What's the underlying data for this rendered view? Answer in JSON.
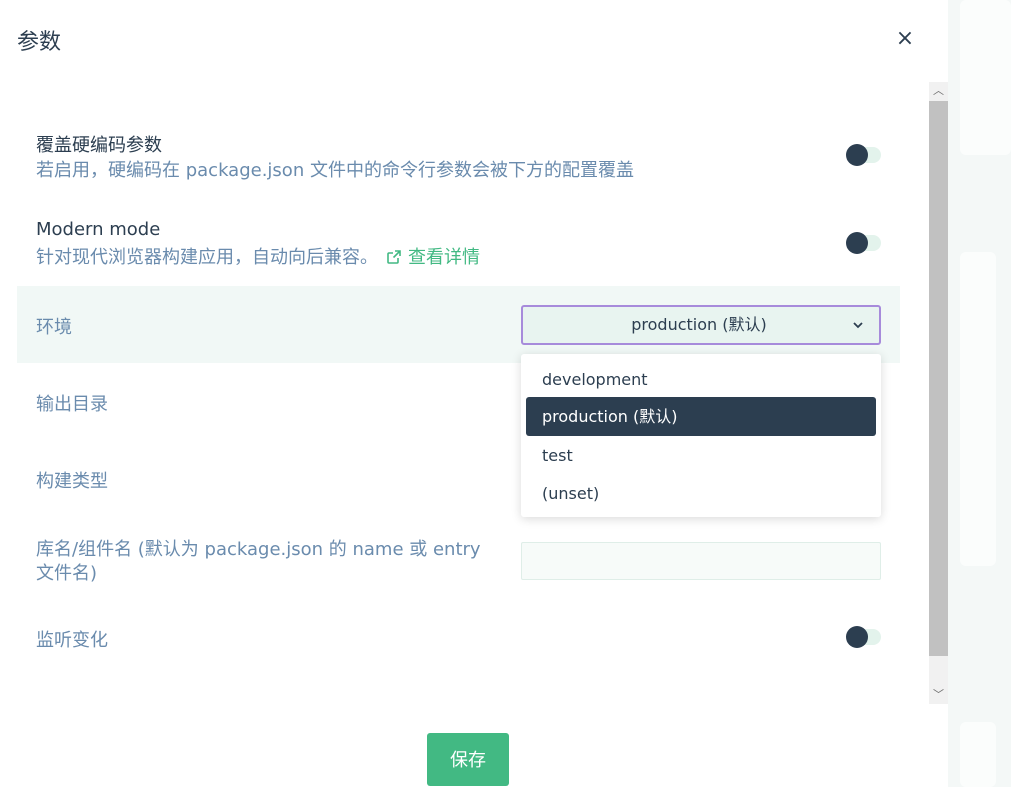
{
  "modal": {
    "title": "参数",
    "close_icon": "close-icon",
    "close_label": "×"
  },
  "settings": {
    "override": {
      "title": "覆盖硬编码参数",
      "description": "若启用，硬编码在 package.json 文件中的命令行参数会被下方的配置覆盖",
      "enabled": false
    },
    "modern": {
      "title": "Modern mode",
      "description": "针对现代浏览器构建应用，自动向后兼容。",
      "link_label": "查看详情",
      "link_icon": "external-link-icon",
      "enabled": false
    },
    "env": {
      "label": "环境",
      "selected": "production (默认)",
      "options": [
        "development",
        "production (默认)",
        "test",
        "(unset)"
      ]
    },
    "output_dir": {
      "label": "输出目录"
    },
    "build_type": {
      "label": "构建类型"
    },
    "lib_name": {
      "label": "库名/组件名 (默认为 package.json 的 name 或 entry 文件名)",
      "value": ""
    },
    "watch": {
      "label": "监听变化",
      "enabled": false
    }
  },
  "footer": {
    "save_label": "保存"
  },
  "colors": {
    "accent": "#42b983",
    "dark": "#2c3e50",
    "muted_text": "#6a8bad",
    "focus_border": "#a78bdb"
  }
}
